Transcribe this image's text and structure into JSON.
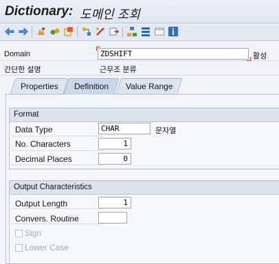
{
  "window": {
    "title_bold": "Dictionary:",
    "title_rest": "도메인 조회"
  },
  "toolbar": {
    "icons": [
      "back-icon",
      "forward-icon",
      "other-object-icon",
      "display-change-icon",
      "activate-icon",
      "where-used-icon",
      "object-list-icon",
      "navigation-icon",
      "hierarchy-icon",
      "append-icon",
      "documentation-icon",
      "info-icon"
    ]
  },
  "header": {
    "domain_label": "Domain",
    "domain_value": "ZDSHIFT",
    "status": "활성",
    "short_desc_label": "간단한 설명",
    "short_desc_value": "근무조 분류"
  },
  "tabs": [
    {
      "label": "Properties",
      "active": false
    },
    {
      "label": "Definition",
      "active": true
    },
    {
      "label": "Value Range",
      "active": false
    }
  ],
  "format": {
    "title": "Format",
    "data_type_label": "Data Type",
    "data_type_value": "CHAR",
    "data_type_desc": "문자열",
    "no_chars_label": "No. Characters",
    "no_chars_value": "1",
    "decimal_label": "Decimal Places",
    "decimal_value": "0"
  },
  "output": {
    "title": "Output Characteristics",
    "length_label": "Output Length",
    "length_value": "1",
    "convers_label": "Convers. Routine",
    "convers_value": "",
    "sign_label": "Sign",
    "lowercase_label": "Lower Case"
  }
}
